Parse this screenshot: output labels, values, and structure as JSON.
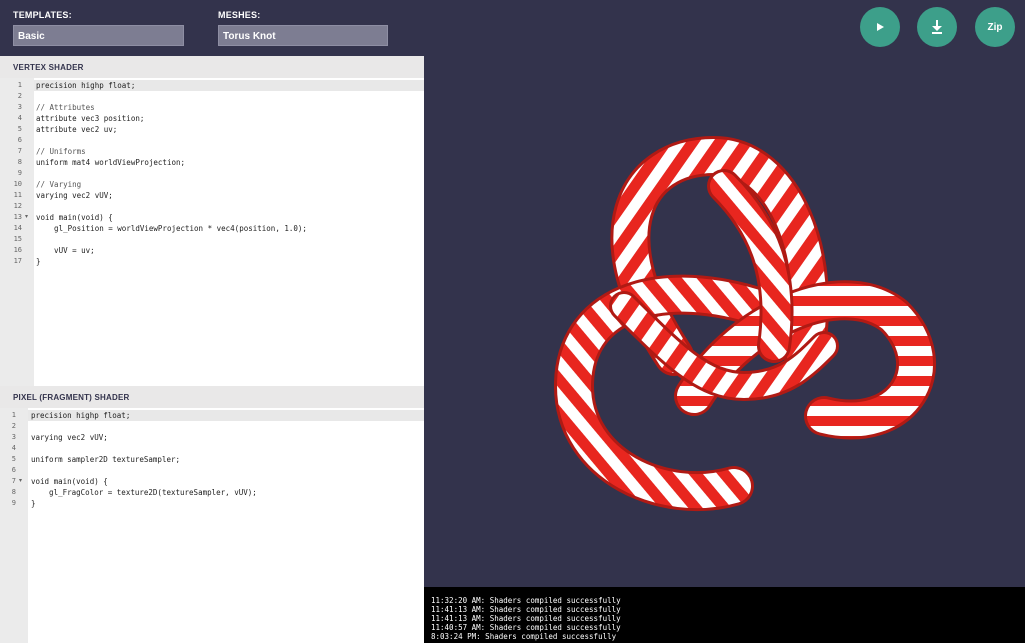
{
  "topbar": {
    "templates_label": "TEMPLATES:",
    "templates_value": "Basic",
    "meshes_label": "MESHES:",
    "meshes_value": "Torus Knot",
    "zip_label": "Zip"
  },
  "vertex": {
    "title": "VERTEX SHADER",
    "lines": [
      "precision highp float;",
      "",
      "// Attributes",
      "attribute vec3 position;",
      "attribute vec2 uv;",
      "",
      "// Uniforms",
      "uniform mat4 worldViewProjection;",
      "",
      "// Varying",
      "varying vec2 vUV;",
      "",
      "void main(void) {",
      "    gl_Position = worldViewProjection * vec4(position, 1.0);",
      "",
      "    vUV = uv;",
      "}"
    ]
  },
  "fragment": {
    "title": "PIXEL (FRAGMENT) SHADER",
    "lines": [
      "precision highp float;",
      "",
      "varying vec2 vUV;",
      "",
      "uniform sampler2D textureSampler;",
      "",
      "void main(void) {",
      "    gl_FragColor = texture2D(textureSampler, vUV);",
      "}"
    ]
  },
  "console": {
    "lines": [
      "11:32:20 AM: Shaders compiled successfully",
      "11:41:13 AM: Shaders compiled successfully",
      "11:41:13 AM: Shaders compiled successfully",
      "11:40:57 AM: Shaders compiled successfully",
      "8:03:24 PM: Shaders compiled successfully"
    ]
  },
  "colors": {
    "accent": "#3d9f8a",
    "background": "#33334c",
    "knot_red": "#e8261f",
    "knot_white": "#ffffff"
  }
}
